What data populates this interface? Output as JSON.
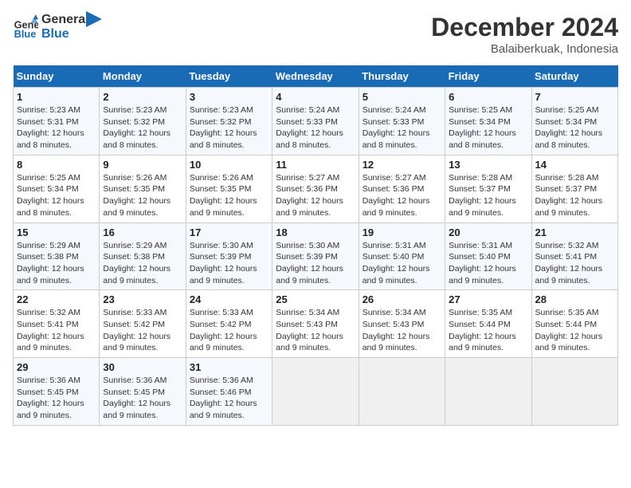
{
  "header": {
    "logo_line1": "General",
    "logo_line2": "Blue",
    "month": "December 2024",
    "location": "Balaiberkuak, Indonesia"
  },
  "weekdays": [
    "Sunday",
    "Monday",
    "Tuesday",
    "Wednesday",
    "Thursday",
    "Friday",
    "Saturday"
  ],
  "weeks": [
    [
      {
        "day": "1",
        "sunrise": "5:23 AM",
        "sunset": "5:31 PM",
        "daylight": "12 hours and 8 minutes."
      },
      {
        "day": "2",
        "sunrise": "5:23 AM",
        "sunset": "5:32 PM",
        "daylight": "12 hours and 8 minutes."
      },
      {
        "day": "3",
        "sunrise": "5:23 AM",
        "sunset": "5:32 PM",
        "daylight": "12 hours and 8 minutes."
      },
      {
        "day": "4",
        "sunrise": "5:24 AM",
        "sunset": "5:33 PM",
        "daylight": "12 hours and 8 minutes."
      },
      {
        "day": "5",
        "sunrise": "5:24 AM",
        "sunset": "5:33 PM",
        "daylight": "12 hours and 8 minutes."
      },
      {
        "day": "6",
        "sunrise": "5:25 AM",
        "sunset": "5:34 PM",
        "daylight": "12 hours and 8 minutes."
      },
      {
        "day": "7",
        "sunrise": "5:25 AM",
        "sunset": "5:34 PM",
        "daylight": "12 hours and 8 minutes."
      }
    ],
    [
      {
        "day": "8",
        "sunrise": "5:25 AM",
        "sunset": "5:34 PM",
        "daylight": "12 hours and 8 minutes."
      },
      {
        "day": "9",
        "sunrise": "5:26 AM",
        "sunset": "5:35 PM",
        "daylight": "12 hours and 9 minutes."
      },
      {
        "day": "10",
        "sunrise": "5:26 AM",
        "sunset": "5:35 PM",
        "daylight": "12 hours and 9 minutes."
      },
      {
        "day": "11",
        "sunrise": "5:27 AM",
        "sunset": "5:36 PM",
        "daylight": "12 hours and 9 minutes."
      },
      {
        "day": "12",
        "sunrise": "5:27 AM",
        "sunset": "5:36 PM",
        "daylight": "12 hours and 9 minutes."
      },
      {
        "day": "13",
        "sunrise": "5:28 AM",
        "sunset": "5:37 PM",
        "daylight": "12 hours and 9 minutes."
      },
      {
        "day": "14",
        "sunrise": "5:28 AM",
        "sunset": "5:37 PM",
        "daylight": "12 hours and 9 minutes."
      }
    ],
    [
      {
        "day": "15",
        "sunrise": "5:29 AM",
        "sunset": "5:38 PM",
        "daylight": "12 hours and 9 minutes."
      },
      {
        "day": "16",
        "sunrise": "5:29 AM",
        "sunset": "5:38 PM",
        "daylight": "12 hours and 9 minutes."
      },
      {
        "day": "17",
        "sunrise": "5:30 AM",
        "sunset": "5:39 PM",
        "daylight": "12 hours and 9 minutes."
      },
      {
        "day": "18",
        "sunrise": "5:30 AM",
        "sunset": "5:39 PM",
        "daylight": "12 hours and 9 minutes."
      },
      {
        "day": "19",
        "sunrise": "5:31 AM",
        "sunset": "5:40 PM",
        "daylight": "12 hours and 9 minutes."
      },
      {
        "day": "20",
        "sunrise": "5:31 AM",
        "sunset": "5:40 PM",
        "daylight": "12 hours and 9 minutes."
      },
      {
        "day": "21",
        "sunrise": "5:32 AM",
        "sunset": "5:41 PM",
        "daylight": "12 hours and 9 minutes."
      }
    ],
    [
      {
        "day": "22",
        "sunrise": "5:32 AM",
        "sunset": "5:41 PM",
        "daylight": "12 hours and 9 minutes."
      },
      {
        "day": "23",
        "sunrise": "5:33 AM",
        "sunset": "5:42 PM",
        "daylight": "12 hours and 9 minutes."
      },
      {
        "day": "24",
        "sunrise": "5:33 AM",
        "sunset": "5:42 PM",
        "daylight": "12 hours and 9 minutes."
      },
      {
        "day": "25",
        "sunrise": "5:34 AM",
        "sunset": "5:43 PM",
        "daylight": "12 hours and 9 minutes."
      },
      {
        "day": "26",
        "sunrise": "5:34 AM",
        "sunset": "5:43 PM",
        "daylight": "12 hours and 9 minutes."
      },
      {
        "day": "27",
        "sunrise": "5:35 AM",
        "sunset": "5:44 PM",
        "daylight": "12 hours and 9 minutes."
      },
      {
        "day": "28",
        "sunrise": "5:35 AM",
        "sunset": "5:44 PM",
        "daylight": "12 hours and 9 minutes."
      }
    ],
    [
      {
        "day": "29",
        "sunrise": "5:36 AM",
        "sunset": "5:45 PM",
        "daylight": "12 hours and 9 minutes."
      },
      {
        "day": "30",
        "sunrise": "5:36 AM",
        "sunset": "5:45 PM",
        "daylight": "12 hours and 9 minutes."
      },
      {
        "day": "31",
        "sunrise": "5:36 AM",
        "sunset": "5:46 PM",
        "daylight": "12 hours and 9 minutes."
      },
      null,
      null,
      null,
      null
    ]
  ],
  "labels": {
    "sunrise": "Sunrise:",
    "sunset": "Sunset:",
    "daylight": "Daylight:"
  }
}
